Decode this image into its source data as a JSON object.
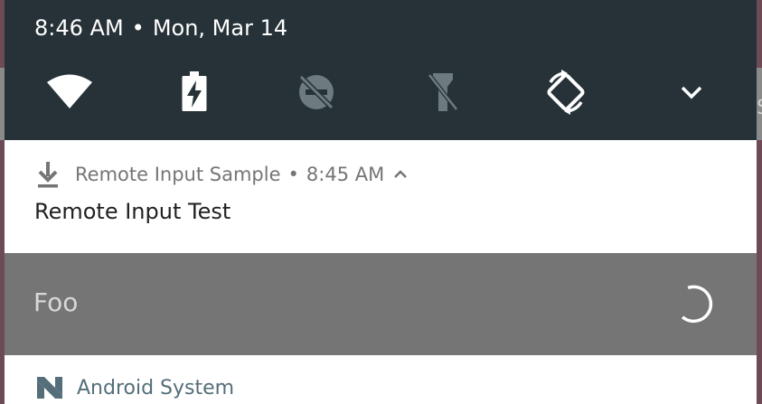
{
  "status": {
    "time": "8:46 AM",
    "separator": "•",
    "date": "Mon, Mar 14"
  },
  "quick_settings": [
    {
      "icon": "wifi-icon"
    },
    {
      "icon": "battery-charging-icon"
    },
    {
      "icon": "do-not-disturb-off-icon"
    },
    {
      "icon": "flashlight-off-icon"
    },
    {
      "icon": "auto-rotate-icon"
    },
    {
      "icon": "chevron-down-icon"
    }
  ],
  "notification": {
    "app_icon": "download-icon",
    "app_name": "Remote Input Sample",
    "separator": "•",
    "time": "8:45 AM",
    "title": "Remote Input Test",
    "reply_text": "Foo"
  },
  "second_notification": {
    "app_icon": "android-n-icon",
    "app_name": "Android System"
  },
  "colors": {
    "header_bg": "#263238",
    "reply_bg": "#757575",
    "card_bg": "#ffffff",
    "wallpaper": "#6e4a57"
  }
}
